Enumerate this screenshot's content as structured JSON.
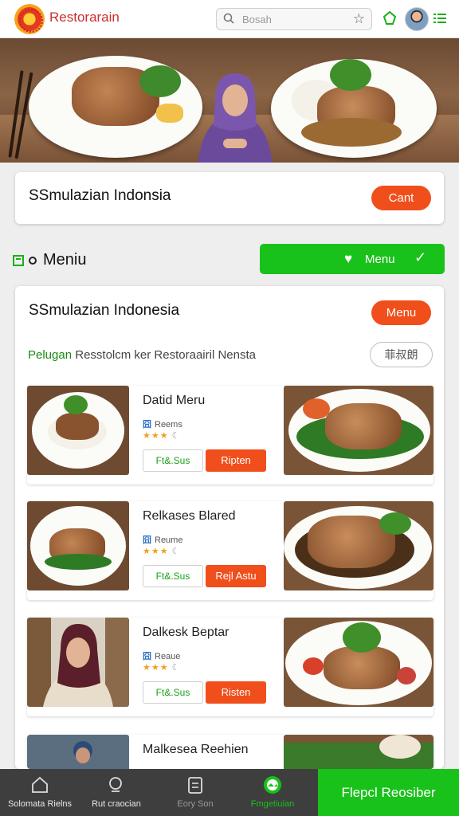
{
  "header": {
    "brand": "Restorarain",
    "search_placeholder": "Bosah"
  },
  "hero_card": {
    "title": "SSmulazian Indonsia",
    "button": "Cant"
  },
  "section": {
    "heading": "Meniu",
    "menu_button": "Menu"
  },
  "menu_card": {
    "title": "SSmulazian Indonesia",
    "button": "Menu",
    "subtitle_green": "Pelugan",
    "subtitle_rest": "Resstolcm ker Restoraairil Nensta",
    "filter_button": "菲叔朗"
  },
  "items": [
    {
      "name": "Datid Meru",
      "sub_tag": "囧",
      "sub": "Reems",
      "stars": "★★★",
      "extra": "☾",
      "btn_outline": "Ft&.Sus",
      "btn_primary": "Ripten"
    },
    {
      "name": "Relkases Blared",
      "sub_tag": "囧",
      "sub": "Reume",
      "stars": "★★★",
      "extra": "☾",
      "btn_outline": "Ft&.Sus",
      "btn_primary": "Rejl Astu"
    },
    {
      "name": "Dalkesk Beptar",
      "sub_tag": "囧",
      "sub": "Reaue",
      "stars": "★★★",
      "extra": "☾",
      "btn_outline": "Ft&.Sus",
      "btn_primary": "Risten"
    },
    {
      "name": "Malkesea Reehien"
    }
  ],
  "bottom_nav": [
    {
      "label": "Solomata Rielns",
      "icon": "home-icon"
    },
    {
      "label": "Rut craocian",
      "icon": "search-icon"
    },
    {
      "label": "Eory Son",
      "icon": "clipboard-icon"
    },
    {
      "label": "Fmgetiuian",
      "icon": "gallery-icon"
    }
  ],
  "bottom_cta": "Flepcl Reosiber",
  "colors": {
    "accent_green": "#19c21a",
    "accent_orange": "#f04e1b",
    "brand_red": "#c9302c"
  }
}
